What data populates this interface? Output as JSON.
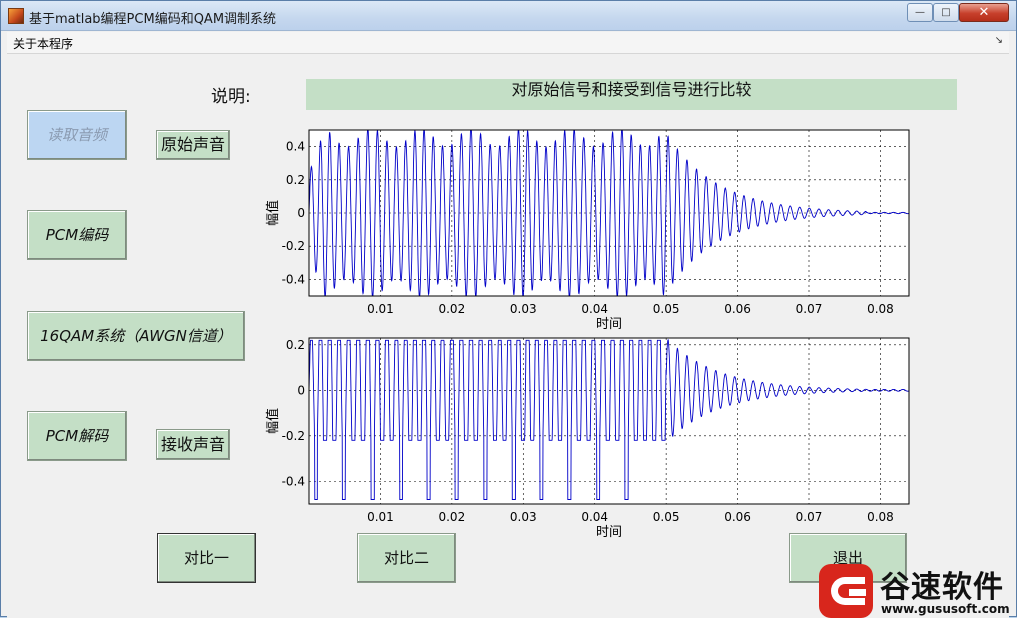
{
  "window": {
    "title": "基于matlab编程PCM编码和QAM调制系统",
    "min_label": "—",
    "max_label": "□",
    "close_label": "✕"
  },
  "menu": {
    "about": "关于本程序",
    "overflow_arrow": "↘"
  },
  "buttons": {
    "read_audio": "读取音频",
    "original_sound": "原始声音",
    "pcm_encode": "PCM编码",
    "qam_system": "16QAM系统（AWGN信道）",
    "pcm_decode": "PCM解码",
    "received_sound": "接收声音",
    "compare1": "对比一",
    "compare2": "对比二",
    "exit": "退出"
  },
  "description": {
    "label": "说明:",
    "text": "对原始信号和接受到信号进行比较"
  },
  "chart_data": [
    {
      "type": "line",
      "xlabel": "时间",
      "ylabel": "幅值",
      "xlim": [
        0.0,
        0.084
      ],
      "ylim": [
        -0.5,
        0.5
      ],
      "xticks": [
        "0.01",
        "0.02",
        "0.03",
        "0.04",
        "0.05",
        "0.06",
        "0.07",
        "0.08"
      ],
      "yticks": [
        "0.4",
        "0.2",
        "0",
        "-0.2",
        "-0.4"
      ],
      "grid": true,
      "series_color": "#0000c8",
      "series": [
        {
          "waveform": "damped-oscillation",
          "frequency_hz": 760,
          "peak_amplitude": 0.48,
          "decay_start": 0.05,
          "decay_end": 0.078
        }
      ]
    },
    {
      "type": "line",
      "xlabel": "时间",
      "ylabel": "幅值",
      "xlim": [
        0.0,
        0.084
      ],
      "ylim": [
        -0.5,
        0.23
      ],
      "xticks": [
        "0.01",
        "0.02",
        "0.03",
        "0.04",
        "0.05",
        "0.06",
        "0.07",
        "0.08"
      ],
      "yticks": [
        "0.2",
        "0",
        "-0.2",
        "-0.4"
      ],
      "grid": true,
      "series_color": "#0000c8",
      "series": [
        {
          "waveform": "damped-oscillation-clipped",
          "frequency_hz": 760,
          "peak_amplitude": 0.23,
          "clip_high": 0.22,
          "clip_low": -0.22,
          "spike_low": -0.48,
          "decay_start": 0.05,
          "decay_end": 0.078
        }
      ]
    }
  ],
  "watermark": {
    "name": "谷速软件",
    "url": "www.gususoft.com"
  }
}
